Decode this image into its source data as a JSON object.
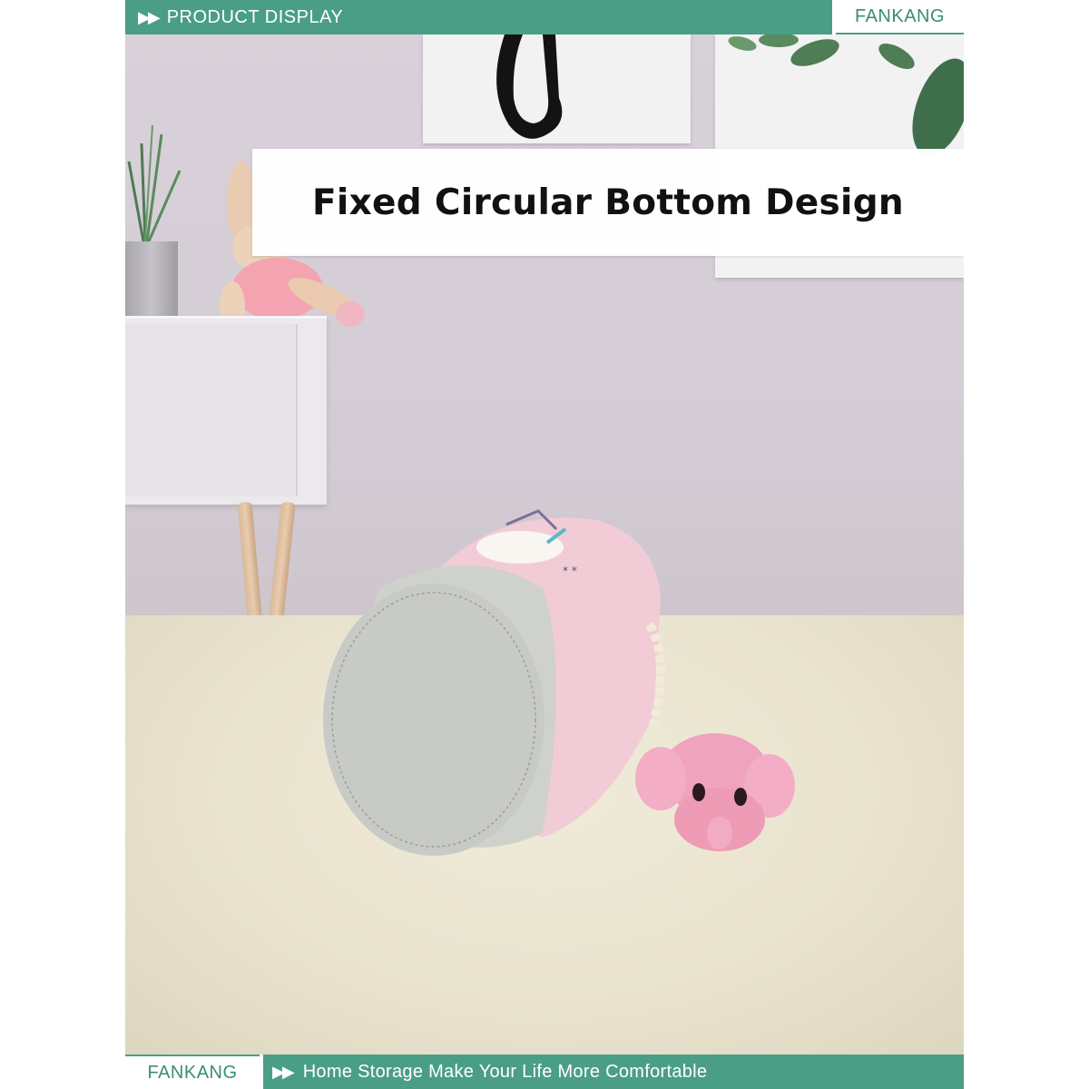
{
  "header": {
    "arrows": "▶▶",
    "title": "PRODUCT DISPLAY",
    "brand": "FANKANG"
  },
  "banner": {
    "text": "Fixed Circular Bottom Design"
  },
  "footer": {
    "brand": "FANKANG",
    "arrows": "▶▶",
    "slogan": "Home Storage Make Your Life More Comfortable"
  },
  "colors": {
    "accent": "#4a9e85",
    "accent_text": "#3b8c76",
    "basket_pink": "#f1ccd6",
    "basket_grey": "#cfd1cd"
  },
  "icons": {
    "header_arrows": "double-play-arrow-icon",
    "footer_arrows": "double-play-arrow-icon"
  }
}
